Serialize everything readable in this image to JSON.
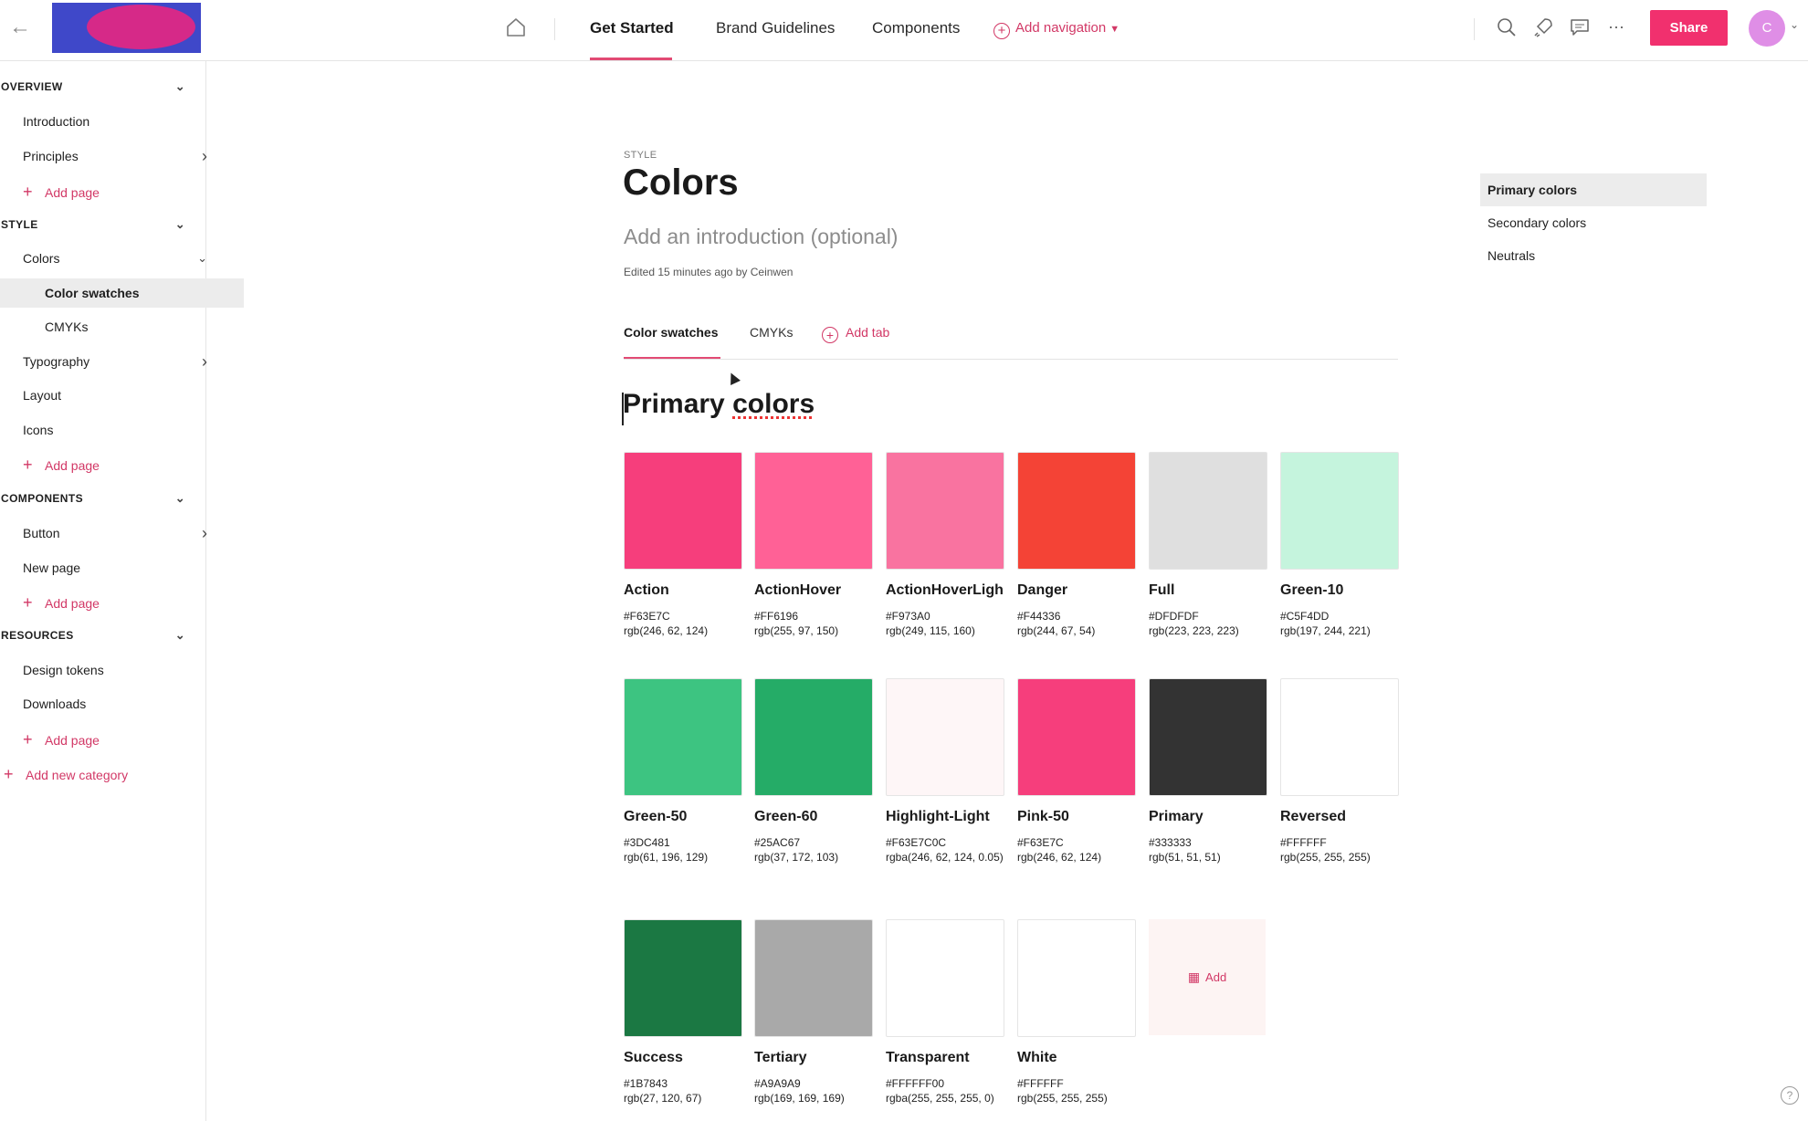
{
  "topbar": {
    "back_icon": "arrow-left-icon",
    "home_icon": "home-icon",
    "tabs": [
      {
        "label": "Get Started",
        "active": true
      },
      {
        "label": "Brand Guidelines",
        "active": false
      },
      {
        "label": "Components",
        "active": false
      }
    ],
    "add_navigation": "Add navigation",
    "tools": [
      "search-icon",
      "rocket-icon",
      "comment-icon",
      "more-icon"
    ],
    "share_label": "Share",
    "avatar_initial": "C",
    "accent": "#F1306E"
  },
  "sidebar": {
    "rows": [
      {
        "type": "category",
        "label": "OVERVIEW",
        "expanded": true
      },
      {
        "type": "item",
        "label": "Introduction"
      },
      {
        "type": "item",
        "label": "Principles",
        "has_children": true
      },
      {
        "type": "add",
        "label": "Add page"
      },
      {
        "type": "category",
        "label": "STYLE",
        "expanded": true
      },
      {
        "type": "item",
        "label": "Colors",
        "expanded": true
      },
      {
        "type": "sub",
        "label": "Color swatches",
        "selected": true
      },
      {
        "type": "sub",
        "label": "CMYKs"
      },
      {
        "type": "item",
        "label": "Typography",
        "has_children": true
      },
      {
        "type": "item",
        "label": "Layout"
      },
      {
        "type": "item",
        "label": "Icons"
      },
      {
        "type": "add",
        "label": "Add page"
      },
      {
        "type": "category",
        "label": "COMPONENTS",
        "expanded": true
      },
      {
        "type": "item",
        "label": "Button",
        "has_children": true
      },
      {
        "type": "item",
        "label": "New page"
      },
      {
        "type": "add",
        "label": "Add page"
      },
      {
        "type": "category",
        "label": "RESOURCES",
        "expanded": true
      },
      {
        "type": "item",
        "label": "Design tokens"
      },
      {
        "type": "item",
        "label": "Downloads"
      },
      {
        "type": "add",
        "label": "Add page"
      },
      {
        "type": "newcat",
        "label": "Add new category"
      }
    ]
  },
  "page": {
    "eyebrow": "STYLE",
    "title": "Colors",
    "intro_placeholder": "Add an introduction (optional)",
    "edited": "Edited 15 minutes ago by Ceinwen",
    "tabs": [
      "Color swatches",
      "CMYKs"
    ],
    "add_tab": "Add tab",
    "section_title_a": "Primary",
    "section_title_b": "colors",
    "add_swatch": "Add"
  },
  "swatches": [
    {
      "name": "Action",
      "hex": "#F63E7C",
      "rgb": "rgb(246, 62, 124)",
      "color": "#F63E7C"
    },
    {
      "name": "ActionHover",
      "hex": "#FF6196",
      "rgb": "rgb(255, 97, 150)",
      "color": "#FF6196"
    },
    {
      "name": "ActionHoverLigh",
      "hex": "#F973A0",
      "rgb": "rgb(249, 115, 160)",
      "color": "#F973A0"
    },
    {
      "name": "Danger",
      "hex": "#F44336",
      "rgb": "rgb(244, 67, 54)",
      "color": "#F44336"
    },
    {
      "name": "Full",
      "hex": "#DFDFDF",
      "rgb": "rgb(223, 223, 223)",
      "color": "#DFDFDF"
    },
    {
      "name": "Green-10",
      "hex": "#C5F4DD",
      "rgb": "rgb(197, 244, 221)",
      "color": "#C5F4DD"
    },
    {
      "name": "Green-50",
      "hex": "#3DC481",
      "rgb": "rgb(61, 196, 129)",
      "color": "#3DC481"
    },
    {
      "name": "Green-60",
      "hex": "#25AC67",
      "rgb": "rgb(37, 172, 103)",
      "color": "#25AC67"
    },
    {
      "name": "Highlight-Light",
      "hex": "#F63E7C0C",
      "rgb": "rgba(246, 62, 124, 0.05)",
      "color": "#FEF6F7"
    },
    {
      "name": "Pink-50",
      "hex": "#F63E7C",
      "rgb": "rgb(246, 62, 124)",
      "color": "#F63E7C"
    },
    {
      "name": "Primary",
      "hex": "#333333",
      "rgb": "rgb(51, 51, 51)",
      "color": "#333333"
    },
    {
      "name": "Reversed",
      "hex": "#FFFFFF",
      "rgb": "rgb(255, 255, 255)",
      "color": "#FFFFFF"
    },
    {
      "name": "Success",
      "hex": "#1B7843",
      "rgb": "rgb(27, 120, 67)",
      "color": "#1B7843"
    },
    {
      "name": "Tertiary",
      "hex": "#A9A9A9",
      "rgb": "rgb(169, 169, 169)",
      "color": "#A9A9A9"
    },
    {
      "name": "Transparent",
      "hex": "#FFFFFF00",
      "rgb": "rgba(255, 255, 255, 0)",
      "color": "#FFFFFF"
    },
    {
      "name": "White",
      "hex": "#FFFFFF",
      "rgb": "rgb(255, 255, 255)",
      "color": "#FFFFFF"
    }
  ],
  "toc": [
    {
      "label": "Primary colors",
      "active": true
    },
    {
      "label": "Secondary colors",
      "active": false
    },
    {
      "label": "Neutrals",
      "active": false
    }
  ]
}
